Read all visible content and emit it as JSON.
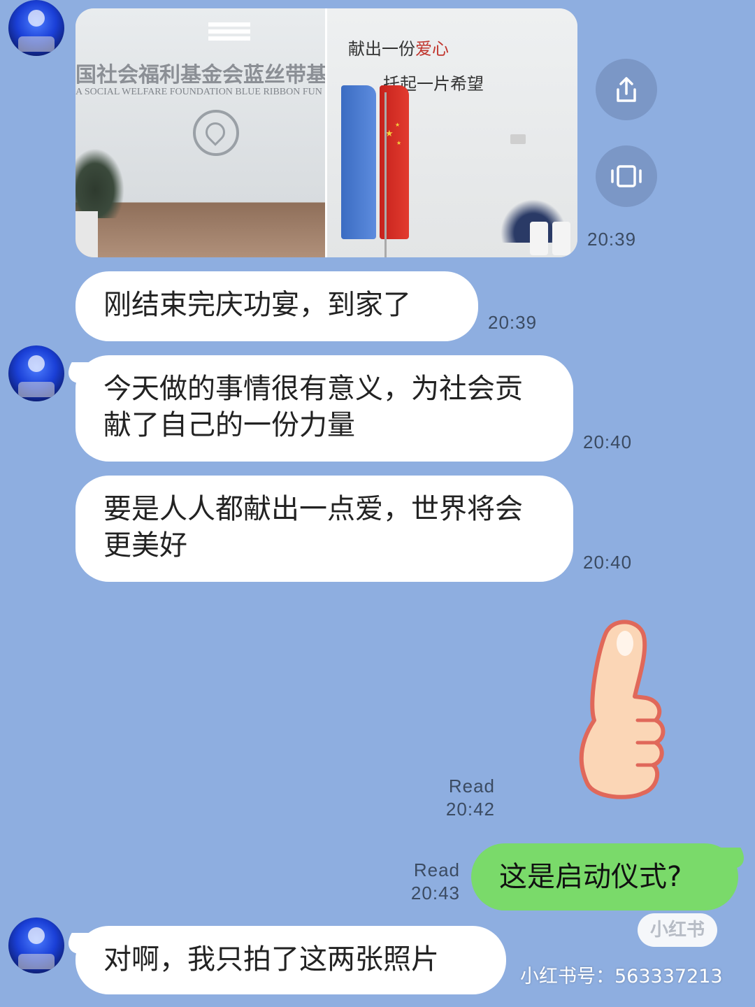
{
  "photo": {
    "left_sign_cn": "国社会福利基金会蓝丝带基",
    "left_sign_en": "A SOCIAL WELFARE FOUNDATION BLUE RIBBON FUN",
    "right_slogan_1": "献出一份",
    "right_slogan_1_red": "爱心",
    "right_slogan_2": "托起一片希望"
  },
  "actions": {
    "share_icon": "share-icon",
    "expand_icon": "expand-icon"
  },
  "messages": [
    {
      "text": "",
      "time": "20:39"
    },
    {
      "text": "刚结束完庆功宴，到家了",
      "time": "20:39"
    },
    {
      "text": "今天做的事情很有意义，为社会贡献了自己的一份力量",
      "time": "20:40"
    },
    {
      "text": "要是人人都献出一点爱，世界将会更美好",
      "time": "20:40"
    }
  ],
  "sent": [
    {
      "status": "Read",
      "time": "20:42",
      "sticker": "thumbs-up"
    },
    {
      "status": "Read",
      "time": "20:43",
      "text": "这是启动仪式?"
    }
  ],
  "reply": {
    "text": "对啊，我只拍了这两张照片"
  },
  "watermark": {
    "badge": "小红书",
    "account": "小红书号：563337213"
  },
  "colors": {
    "background": "#8eaee0",
    "incoming_bubble": "#ffffff",
    "outgoing_bubble": "#7ada6a",
    "timestamp": "#3b4b62"
  }
}
